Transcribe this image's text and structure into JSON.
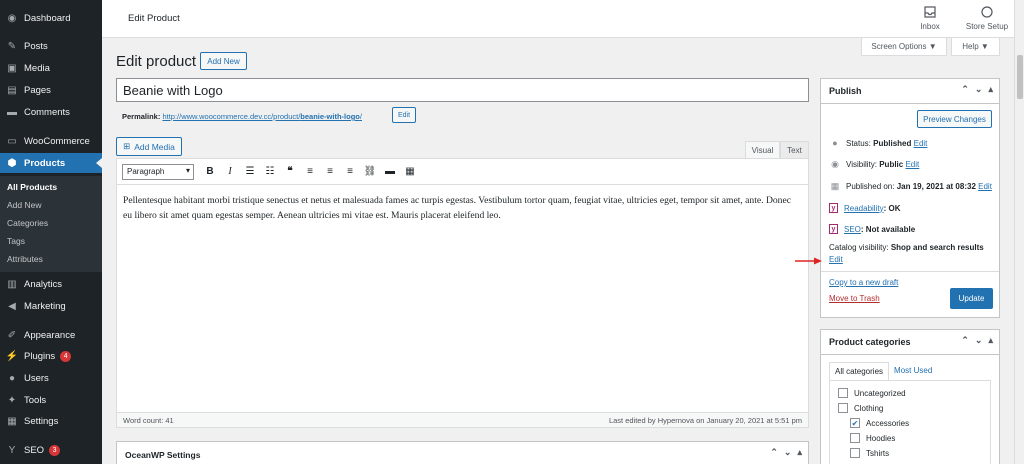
{
  "sidebar": {
    "dashboard": "Dashboard",
    "posts": "Posts",
    "media": "Media",
    "pages": "Pages",
    "comments": "Comments",
    "woocommerce": "WooCommerce",
    "products": "Products",
    "sub": {
      "all_products": "All Products",
      "add_new": "Add New",
      "categories": "Categories",
      "tags": "Tags",
      "attributes": "Attributes"
    },
    "analytics": "Analytics",
    "marketing": "Marketing",
    "appearance": "Appearance",
    "plugins": "Plugins",
    "plugins_badge": "4",
    "users": "Users",
    "tools": "Tools",
    "settings": "Settings",
    "seo": "SEO",
    "seo_badge": "3"
  },
  "topbar": {
    "title": "Edit Product",
    "inbox": "Inbox",
    "store_setup": "Store Setup"
  },
  "screen_options": "Screen Options ▼",
  "help": "Help ▼",
  "page": {
    "heading": "Edit product",
    "add_new": "Add New",
    "title_value": "Beanie with Logo",
    "permalink_label": "Permalink:",
    "permalink_base": "http://www.woocommerce.dev.cc/product/",
    "permalink_slug": "beanie-with-logo",
    "permalink_end": "/",
    "permalink_edit": "Edit"
  },
  "editor": {
    "add_media": "Add Media",
    "tab_visual": "Visual",
    "tab_text": "Text",
    "format": "Paragraph",
    "content": "Pellentesque habitant morbi tristique senectus et netus et malesuada fames ac turpis egestas. Vestibulum tortor quam, feugiat vitae, ultricies eget, tempor sit amet, ante. Donec eu libero sit amet quam egestas semper. Aenean ultricies mi vitae est. Mauris placerat eleifend leo.",
    "word_count": "Word count: 41",
    "last_edited": "Last edited by Hypernova on January 20, 2021 at 5:51 pm"
  },
  "oceanwp": {
    "title": "OceanWP Settings"
  },
  "publish": {
    "title": "Publish",
    "preview": "Preview Changes",
    "status_label": "Status:",
    "status_value": "Published",
    "visibility_label": "Visibility:",
    "visibility_value": "Public",
    "published_label": "Published on:",
    "published_value": "Jan 19, 2021 at 08:32",
    "readability_label": "Readability",
    "readability_value": ": OK",
    "seo_label": "SEO",
    "seo_value": ": Not available",
    "catalog_label": "Catalog visibility:",
    "catalog_value": "Shop and search results",
    "edit": "Edit",
    "copy_draft": "Copy to a new draft",
    "trash": "Move to Trash",
    "update": "Update"
  },
  "categories": {
    "title": "Product categories",
    "tab_all": "All categories",
    "tab_most_used": "Most Used",
    "items": [
      {
        "label": "Uncategorized",
        "checked": false
      },
      {
        "label": "Clothing",
        "checked": false
      },
      {
        "label": "Accessories",
        "checked": true
      },
      {
        "label": "Hoodies",
        "checked": false
      },
      {
        "label": "Tshirts",
        "checked": false
      }
    ]
  },
  "colors": {
    "sidebar_bg": "#1d2327",
    "accent": "#2271b1",
    "danger": "#d63638",
    "annotation_arrow": "#e02424"
  }
}
